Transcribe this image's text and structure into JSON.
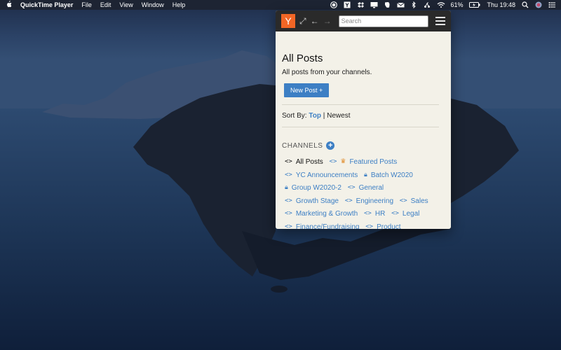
{
  "menubar": {
    "apple_icon": "apple-icon",
    "app_name": "QuickTime Player",
    "menus": [
      "File",
      "Edit",
      "View",
      "Window",
      "Help"
    ],
    "battery": "61%",
    "time": "Thu 19:48"
  },
  "panel": {
    "logo": "Y",
    "search_placeholder": "Search",
    "title": "All Posts",
    "subtitle": "All posts from your channels.",
    "new_post_label": "New Post  +",
    "sort": {
      "label": "Sort By:",
      "top": "Top",
      "separator": "|",
      "newest": "Newest"
    },
    "channels_title": "CHANNELS",
    "channels": [
      {
        "label": "All Posts",
        "icon": "code-icon"
      },
      {
        "label": "Featured Posts",
        "icon": "crown-icon"
      },
      {
        "label": "YC Announcements",
        "icon": "code-icon"
      },
      {
        "label": "Batch W2020",
        "icon": "lock-icon"
      },
      {
        "label": "Group W2020-2",
        "icon": "lock-icon"
      },
      {
        "label": "General",
        "icon": "code-icon"
      },
      {
        "label": "Growth Stage",
        "icon": "code-icon"
      },
      {
        "label": "Engineering",
        "icon": "code-icon"
      },
      {
        "label": "Sales",
        "icon": "code-icon"
      },
      {
        "label": "Marketing & Growth",
        "icon": "code-icon"
      },
      {
        "label": "HR",
        "icon": "code-icon"
      },
      {
        "label": "Legal",
        "icon": "code-icon"
      },
      {
        "label": "Finance/Fundraising",
        "icon": "code-icon"
      },
      {
        "label": "Product",
        "icon": "code-icon"
      }
    ]
  },
  "colors": {
    "accent": "#3d7fc4",
    "logo_bg": "#f26625",
    "panel_bg": "#f3f1e8",
    "toolbar_bg": "#2a2a2a"
  }
}
